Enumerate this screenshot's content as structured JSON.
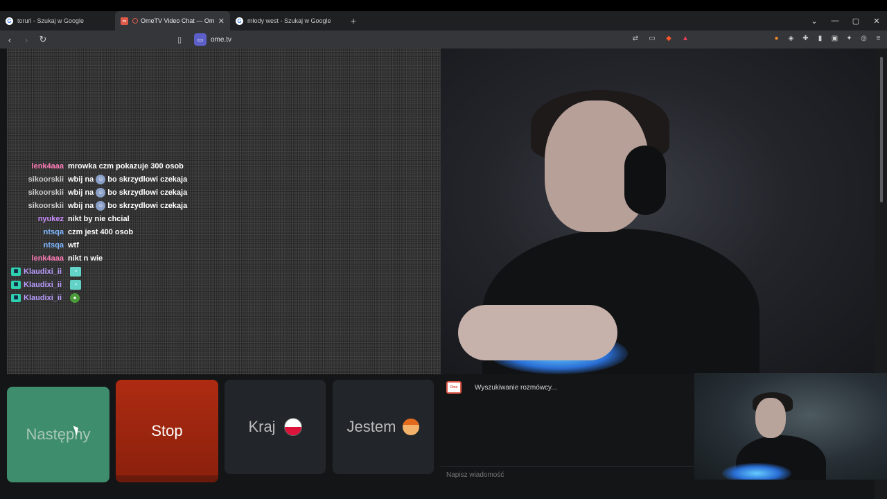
{
  "browser": {
    "tabs": [
      {
        "title": "toruń - Szukaj w Google",
        "favicon": "google-icon",
        "active": false
      },
      {
        "title": "OmeTV Video Chat — Omegle",
        "favicon": "ometv-icon",
        "active": true,
        "close": "✕"
      },
      {
        "title": "młody west - Szukaj w Google",
        "favicon": "google-icon",
        "active": false
      }
    ],
    "new_tab": "+",
    "url": "ome.tv"
  },
  "chat_overlay": {
    "messages": [
      {
        "user": "lenk4aaa",
        "color": "#ff7cb8",
        "text": "mrowka czm pokazuje 300 osob"
      },
      {
        "user": "sikoorskii",
        "color": "#c9c9c9",
        "text_before": "wbij na",
        "text_after": "bo skrzydlowi czekaja"
      },
      {
        "user": "sikoorskii",
        "color": "#c9c9c9",
        "text_before": "wbij na",
        "text_after": "bo skrzydlowi czekaja"
      },
      {
        "user": "sikoorskii",
        "color": "#c9c9c9",
        "text_before": "wbij na",
        "text_after": "bo skrzydlowi czekaja"
      },
      {
        "user": "nyukez",
        "color": "#c98cff",
        "text": "nikt by nie chcial"
      },
      {
        "user": "ntsqa",
        "color": "#7fb7ff",
        "text": "czm jest 400 osob"
      },
      {
        "user": "ntsqa",
        "color": "#7fb7ff",
        "text": "wtf"
      },
      {
        "user": "lenk4aaa",
        "color": "#ff7cb8",
        "text": "nikt n wie"
      },
      {
        "user": "Klaudixi_ii",
        "color": "#b99cff",
        "badge": true
      },
      {
        "user": "Klaudixi_ii",
        "color": "#b99cff",
        "badge": true
      },
      {
        "user": "Klaudixi_ii",
        "color": "#b99cff",
        "badge": true
      }
    ]
  },
  "controls": {
    "next_label": "Następny",
    "stop_label": "Stop",
    "country_label": "Kraj",
    "gender_label": "Jestem"
  },
  "chat_panel": {
    "status": "Wyszukiwanie rozmówcy...",
    "placeholder": "Napisz wiadomość"
  },
  "colors": {
    "next": "#3e8d6d",
    "stop": "#ae2b12",
    "neutral_button": "#22262a"
  }
}
